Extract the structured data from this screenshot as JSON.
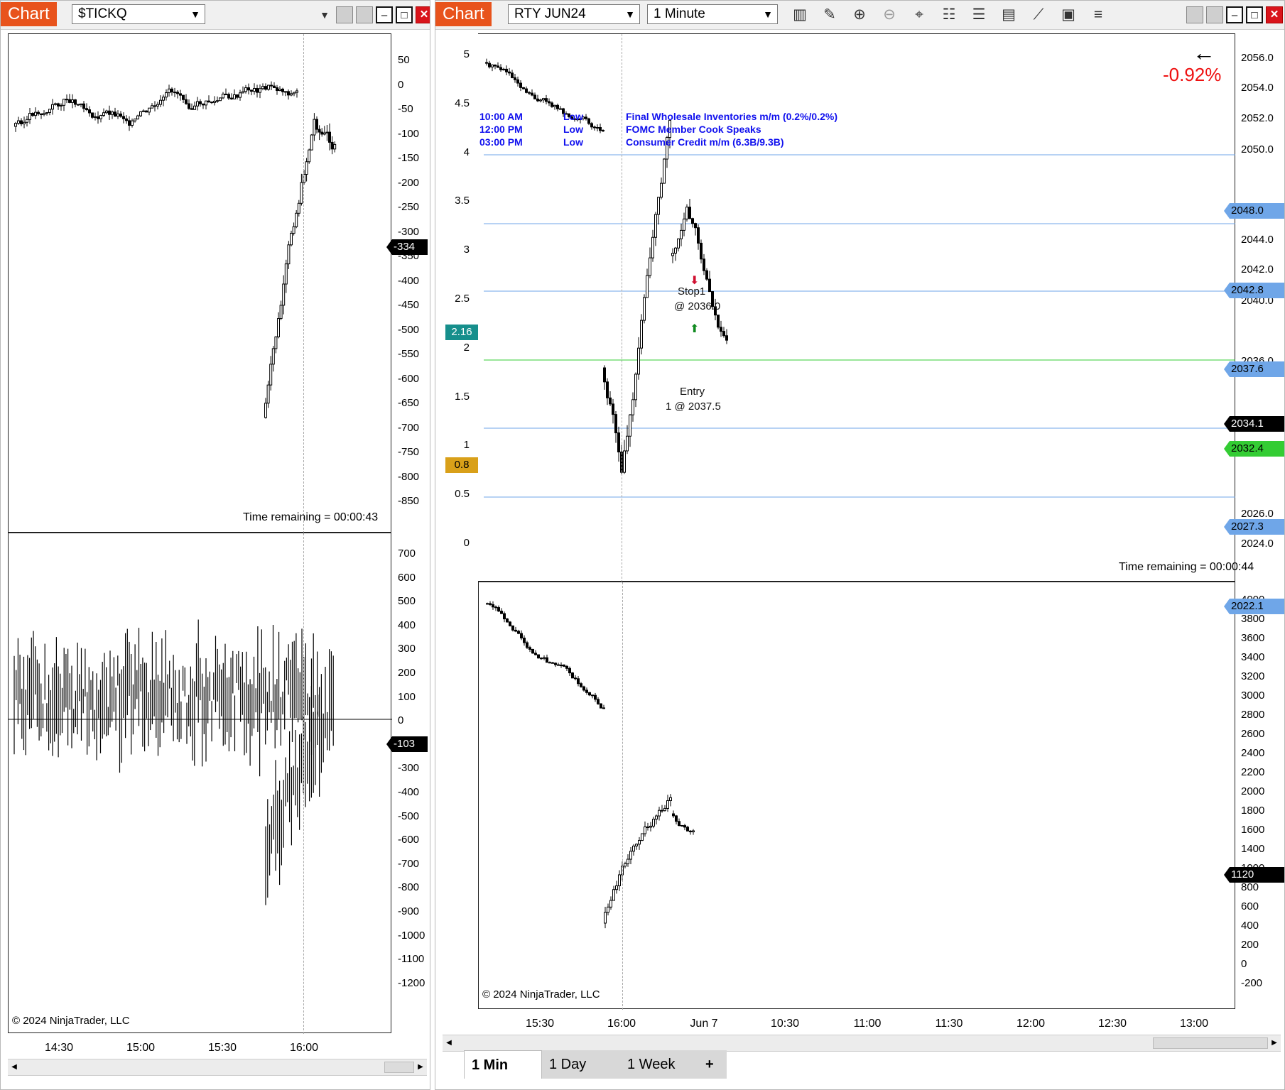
{
  "left_window": {
    "chart_label": "Chart",
    "instrument": "$TICKQ",
    "top_panel": {
      "y_ticks": [
        "50",
        "0",
        "-50",
        "-100",
        "-150",
        "-200",
        "-250",
        "-300",
        "-350",
        "-400",
        "-450",
        "-500",
        "-550",
        "-600",
        "-650",
        "-700",
        "-750",
        "-800",
        "-850"
      ],
      "last_value": "-334",
      "time_remaining": "Time remaining = 00:00:43"
    },
    "bottom_panel": {
      "y_ticks": [
        "700",
        "600",
        "500",
        "400",
        "300",
        "200",
        "100",
        "0",
        "-200",
        "-300",
        "-400",
        "-500",
        "-600",
        "-700",
        "-800",
        "-900",
        "-1000",
        "-1100",
        "-1200"
      ],
      "last_value": "-103",
      "copyright": "© 2024 NinjaTrader, LLC"
    },
    "x_ticks": [
      "14:30",
      "15:00",
      "15:30",
      "16:00"
    ]
  },
  "right_window": {
    "chart_label": "Chart",
    "instrument": "RTY JUN24",
    "interval": "1 Minute",
    "toolbar_icons": [
      "bar-type-icon",
      "pencil-drawing-icon",
      "zoom-in-icon",
      "zoom-out-icon",
      "crosshair-icon",
      "data-box-icon",
      "properties-icon",
      "strategies-icon",
      "indicators-icon",
      "templates-icon",
      "more-menu-icon"
    ],
    "price_panel": {
      "left_y_ticks": [
        "5",
        "4.5",
        "4",
        "3.5",
        "3",
        "2.5",
        "2",
        "1.5",
        "1",
        "0.5",
        "0"
      ],
      "right_y_ticks": [
        "2056.0",
        "2054.0",
        "2052.0",
        "2050.0",
        "2046.0",
        "2044.0",
        "2042.0",
        "2040.0",
        "2036.0",
        "2030.0",
        "2026.0",
        "2024.0"
      ],
      "left_markers": [
        {
          "value": "2.16",
          "color": "#168f8c"
        },
        {
          "value": "0.8",
          "color": "#d9a019"
        }
      ],
      "price_tags": [
        {
          "value": "2048.0",
          "color": "#6fa6e8"
        },
        {
          "value": "2042.8",
          "color": "#6fa6e8"
        },
        {
          "value": "2037.6",
          "color": "#6fa6e8"
        },
        {
          "value": "2034.1",
          "color": "#000000"
        },
        {
          "value": "2032.4",
          "color": "#33cc33"
        },
        {
          "value": "2027.3",
          "color": "#6fa6e8"
        },
        {
          "value": "2022.1",
          "color": "#6fa6e8"
        }
      ],
      "change_pct": "-0.92%",
      "events": [
        {
          "time": "10:00 AM",
          "impact": "Low",
          "title": "Final Wholesale Inventories m/m (0.2%/0.2%)"
        },
        {
          "time": "12:00 PM",
          "impact": "Low",
          "title": "FOMC Member Cook Speaks"
        },
        {
          "time": "03:00 PM",
          "impact": "Low",
          "title": "Consumer Credit m/m (6.3B/9.3B)"
        }
      ],
      "stop_label": "Stop1",
      "stop_price": "@ 2036.0",
      "entry_label": "Entry",
      "entry_price": "1 @ 2037.5",
      "time_remaining": "Time remaining = 00:00:44"
    },
    "volume_panel": {
      "y_ticks": [
        "4000",
        "3800",
        "3600",
        "3400",
        "3200",
        "3000",
        "2800",
        "2600",
        "2400",
        "2200",
        "2000",
        "1800",
        "1600",
        "1400",
        "1000",
        "800",
        "600",
        "400",
        "200",
        "0",
        "-200"
      ],
      "last_value": "1120",
      "copyright": "© 2024 NinjaTrader, LLC"
    },
    "x_ticks": [
      "15:30",
      "16:00",
      "Jun 7",
      "10:30",
      "11:00",
      "11:30",
      "12:00",
      "12:30",
      "13:00"
    ],
    "tabs": [
      "1 Min",
      "1 Day",
      "1 Week"
    ],
    "add_tab": "+"
  }
}
